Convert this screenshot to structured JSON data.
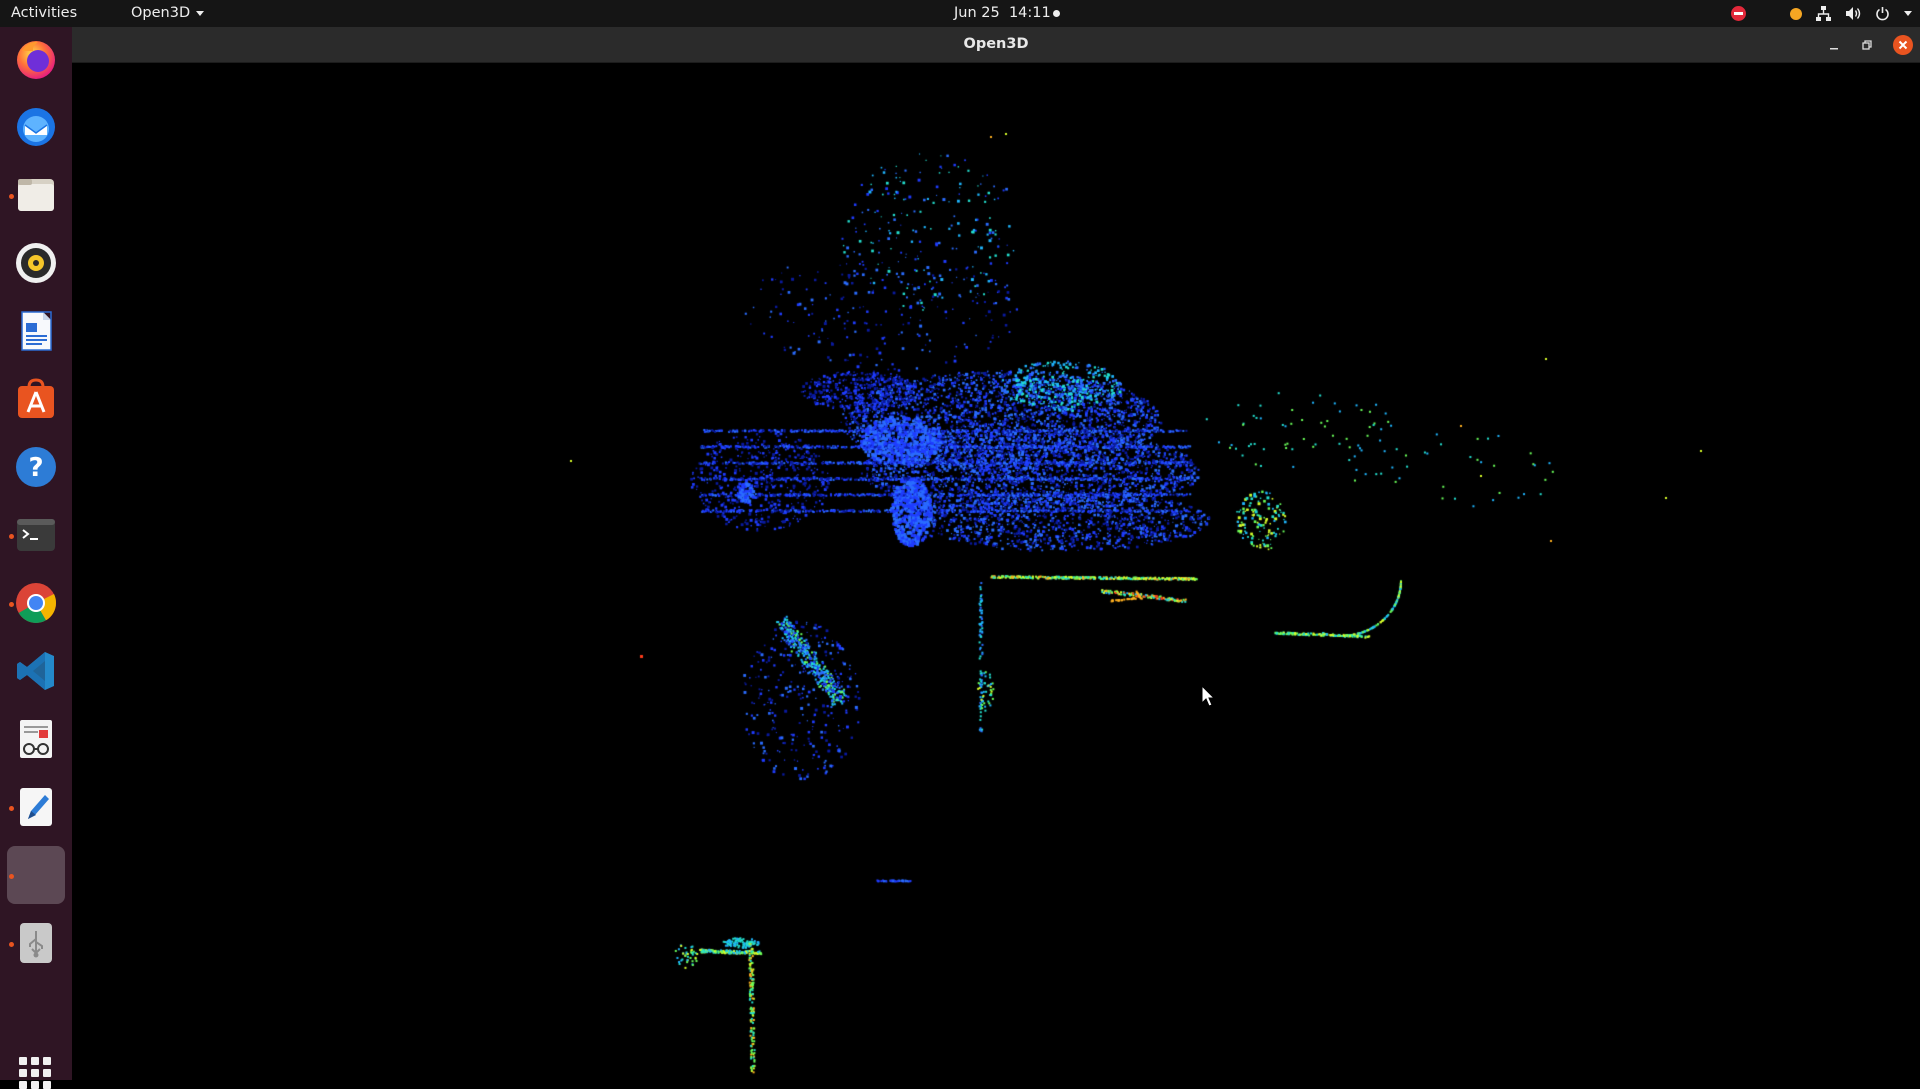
{
  "topbar": {
    "activities": "Activities",
    "app_menu": "Open3D",
    "date": "Jun 25",
    "time": "14:11",
    "icons": [
      "do-not-disturb-icon",
      "notification-dot-icon",
      "network-icon",
      "volume-icon",
      "power-icon",
      "system-menu-caret-icon"
    ]
  },
  "dock": {
    "items": [
      {
        "name": "firefox",
        "running": false
      },
      {
        "name": "thunderbird",
        "running": false
      },
      {
        "name": "files",
        "running": true
      },
      {
        "name": "rhythmbox",
        "running": false
      },
      {
        "name": "libreoffice-writer",
        "running": false
      },
      {
        "name": "ubuntu-software",
        "running": false
      },
      {
        "name": "help",
        "running": false
      },
      {
        "name": "terminal",
        "running": true
      },
      {
        "name": "chrome",
        "running": true
      },
      {
        "name": "vscode",
        "running": false
      },
      {
        "name": "document-viewer",
        "running": false
      },
      {
        "name": "text-editor",
        "running": true
      },
      {
        "name": "open3d",
        "running": true,
        "active": true
      },
      {
        "name": "usb-drive",
        "running": true
      }
    ],
    "show_apps": "show-applications-icon"
  },
  "window": {
    "title": "Open3D",
    "buttons": [
      "minimize",
      "maximize",
      "close"
    ]
  },
  "viewport": {
    "content": "point-cloud",
    "background": "#000000",
    "colormap": [
      "#0a1aa0",
      "#1f3cff",
      "#2a6cff",
      "#1fb6ff",
      "#23e0d0",
      "#6aff5a",
      "#d9ff2a",
      "#ffb020",
      "#ff3b1a"
    ]
  }
}
